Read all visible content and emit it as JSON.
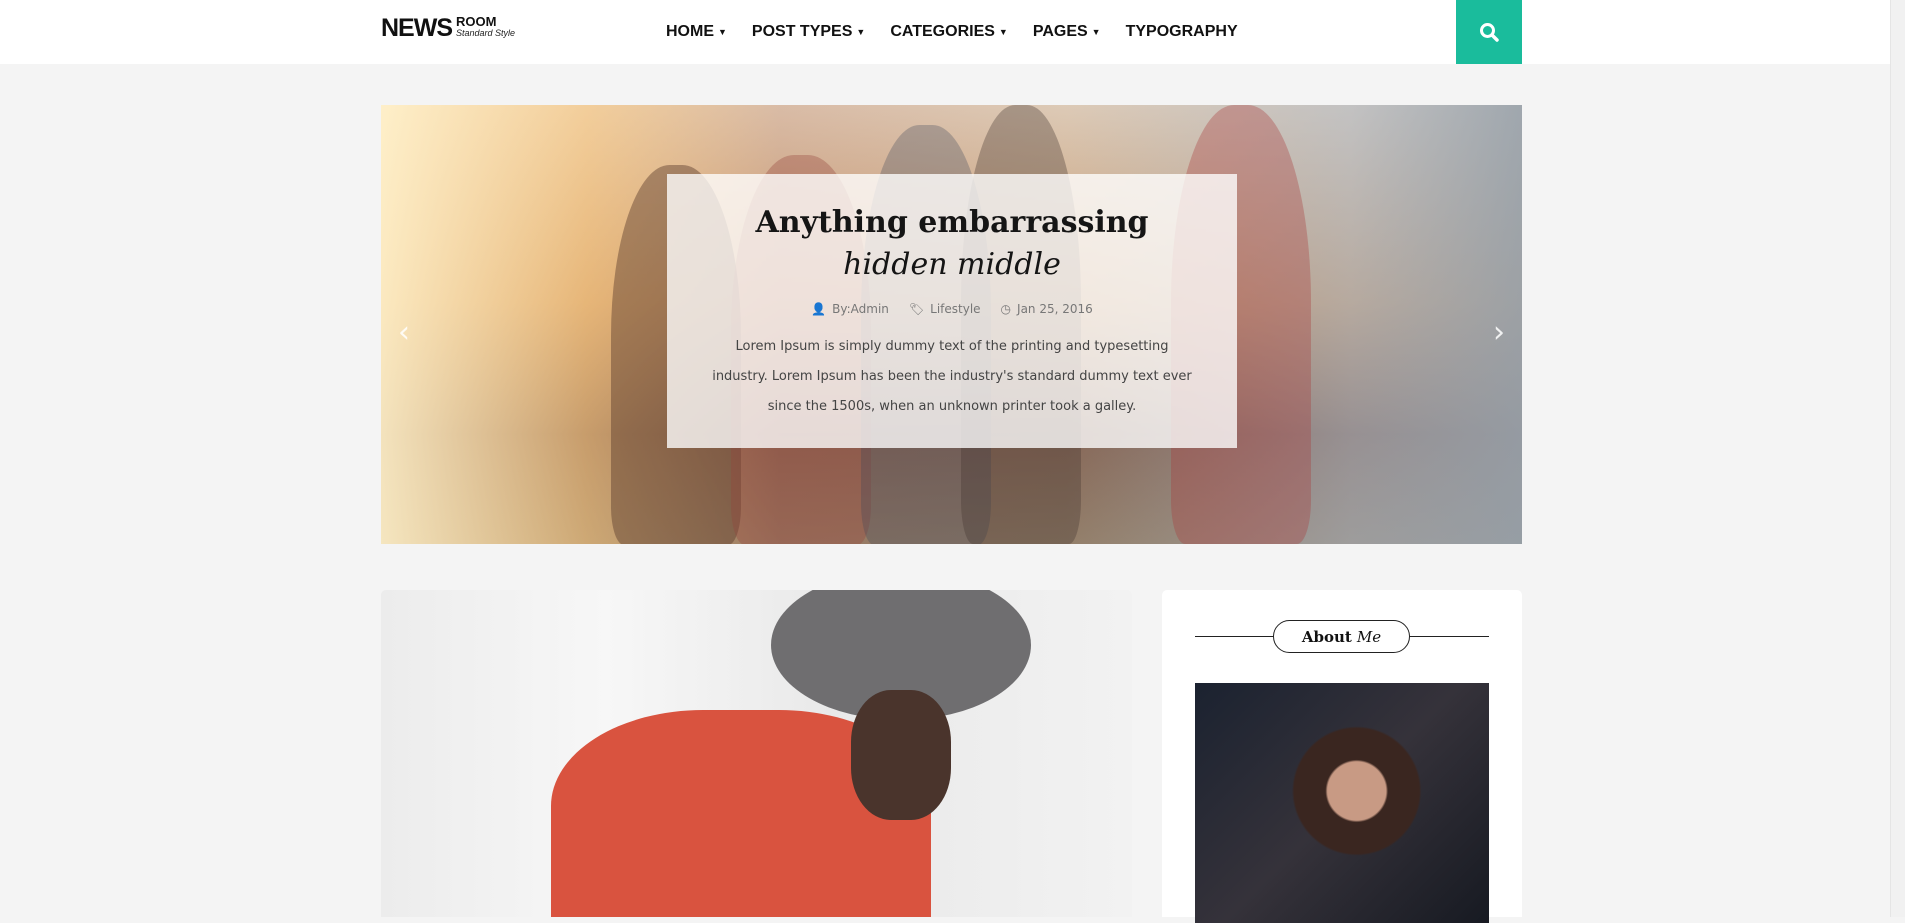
{
  "header": {
    "logo": {
      "main": "NEWS",
      "sub": "ROOM",
      "tagline": "Standard Style"
    },
    "nav": [
      {
        "label": "HOME",
        "dropdown": true
      },
      {
        "label": "POST TYPES",
        "dropdown": true
      },
      {
        "label": "CATEGORIES",
        "dropdown": true
      },
      {
        "label": "PAGES",
        "dropdown": true
      },
      {
        "label": "TYPOGRAPHY",
        "dropdown": false
      }
    ],
    "search_icon": "search-icon",
    "accent": "#1abc9c"
  },
  "slider": {
    "title_bold": "Anything embarrassing",
    "title_italic": "hidden middle",
    "author": "By:Admin",
    "category": "Lifestyle",
    "date": "Jan 25, 2016",
    "excerpt": "Lorem Ipsum is simply dummy text of the printing and typesetting industry. Lorem Ipsum has been the industry's standard dummy text ever since the 1500s, when an unknown printer took a galley.",
    "prev_icon": "chevron-left-icon",
    "next_icon": "chevron-right-icon"
  },
  "sidebar": {
    "widget_title_bold": "About",
    "widget_title_italic": "Me"
  }
}
